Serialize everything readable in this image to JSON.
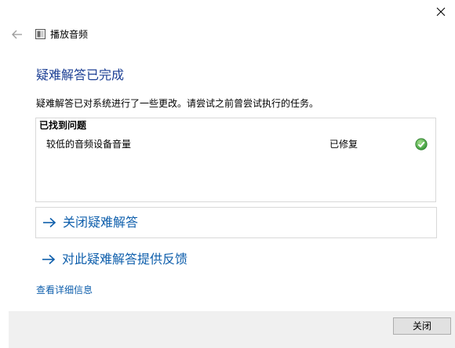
{
  "window": {
    "app_title": "播放音频"
  },
  "page": {
    "title": "疑难解答已完成",
    "description": "疑难解答已对系统进行了一些更改。请尝试之前曾尝试执行的任务。"
  },
  "problems": {
    "header": "已找到问题",
    "items": [
      {
        "name": "较低的音频设备音量",
        "status": "已修复",
        "status_icon": "check-icon"
      }
    ]
  },
  "links": {
    "close_troubleshooter": "关闭疑难解答",
    "feedback": "对此疑难解答提供反馈",
    "view_details": "查看详细信息"
  },
  "footer": {
    "close_button": "关闭"
  },
  "colors": {
    "title": "#1c3f94",
    "link": "#0f5fac",
    "success": "#3ea543",
    "footer_bg": "#f0f0f0"
  }
}
